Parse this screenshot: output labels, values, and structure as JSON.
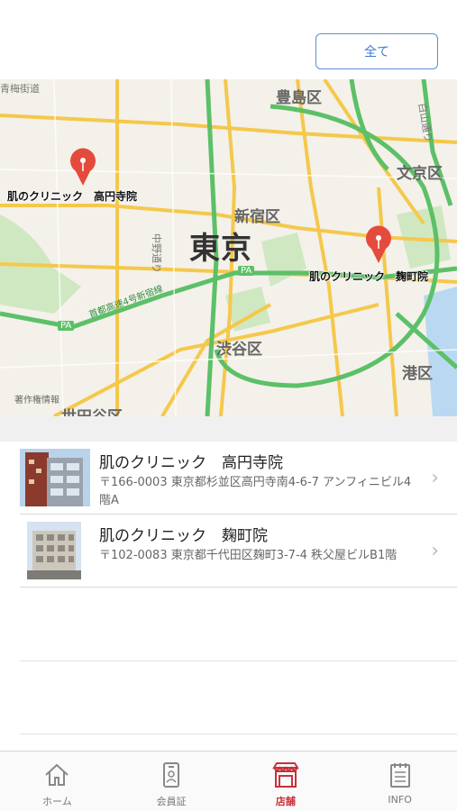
{
  "header": {
    "filter_button_label": "全て"
  },
  "map": {
    "center_label": "東京",
    "ward_labels": [
      "豊島区",
      "文京区",
      "新宿区",
      "渋谷区",
      "港区",
      "世田谷区"
    ],
    "small_labels": [
      "青梅街道",
      "白山通り",
      "中野通り"
    ],
    "expressway_label": "首都高速4号新宿線",
    "pa_badge": "PA",
    "legal_link": "著作権情報",
    "pins": [
      {
        "label": "肌のクリニック　高円寺院"
      },
      {
        "label": "肌のクリニック　麹町院"
      }
    ]
  },
  "clinics": [
    {
      "name": "肌のクリニック　高円寺院",
      "address": "〒166-0003 東京都杉並区高円寺南4-6-7 アンフィニビル4階A"
    },
    {
      "name": "肌のクリニック　麹町院",
      "address": "〒102-0083 東京都千代田区麹町3-7-4 秩父屋ビルB1階"
    }
  ],
  "tabbar": {
    "items": [
      {
        "label": "ホーム",
        "icon": "home-icon"
      },
      {
        "label": "会員証",
        "icon": "member-card-icon"
      },
      {
        "label": "店舗",
        "icon": "store-icon"
      },
      {
        "label": "INFO",
        "icon": "info-icon"
      }
    ],
    "active_index": 2
  },
  "colors": {
    "accent_red": "#c8313b",
    "link_blue": "#3b7bd4",
    "road_yellow": "#f5c84c",
    "road_green": "#5cc068"
  }
}
